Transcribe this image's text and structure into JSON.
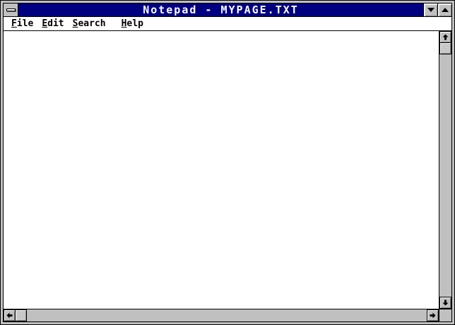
{
  "window": {
    "title": "Notepad - MYPAGE.TXT",
    "app_name": "Notepad",
    "document_name": "MYPAGE.TXT"
  },
  "titlebar": {
    "system_menu_icon": "dash-icon",
    "minimize_icon": "down-triangle-icon",
    "maximize_icon": "up-triangle-icon"
  },
  "menu": {
    "items": [
      {
        "label": "File",
        "mnemonic": "F"
      },
      {
        "label": "Edit",
        "mnemonic": "E"
      },
      {
        "label": "Search",
        "mnemonic": "S"
      },
      {
        "label": "Help",
        "mnemonic": "H"
      }
    ]
  },
  "editor": {
    "content": ""
  },
  "scrollbars": {
    "vertical": {
      "up_icon": "up-arrow-icon",
      "down_icon": "down-arrow-icon",
      "thumb_position": "top"
    },
    "horizontal": {
      "left_icon": "left-arrow-icon",
      "right_icon": "right-arrow-icon",
      "thumb_position": "left"
    }
  },
  "colors": {
    "title_bar": "#000080",
    "title_text": "#ffffff",
    "chrome": "#c0c0c0",
    "bevel_highlight": "#ffffff",
    "bevel_shadow": "#808080",
    "menu_text": "#000000",
    "editor_background": "#ffffff"
  }
}
